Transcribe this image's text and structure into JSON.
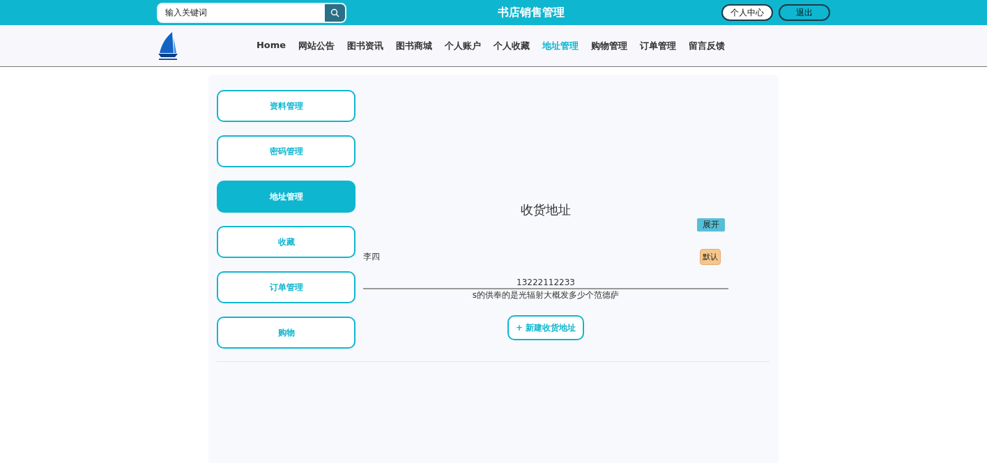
{
  "header": {
    "search": {
      "placeholder": "输入关键词"
    },
    "title": "书店销售管理",
    "buttons": [
      {
        "label": "个人中心",
        "kind": "light"
      },
      {
        "label": "退出",
        "kind": "dark"
      }
    ]
  },
  "nav": {
    "items": [
      {
        "label": "Home",
        "selected": false
      },
      {
        "label": "网站公告",
        "selected": false
      },
      {
        "label": "图书资讯",
        "selected": false
      },
      {
        "label": "图书商城",
        "selected": false
      },
      {
        "label": "个人账户",
        "selected": false
      },
      {
        "label": "个人收藏",
        "selected": false
      },
      {
        "label": "地址管理",
        "selected": true
      },
      {
        "label": "购物管理",
        "selected": false
      },
      {
        "label": "订单管理",
        "selected": false
      },
      {
        "label": "留言反馈",
        "selected": false
      }
    ]
  },
  "sidebar": {
    "items": [
      {
        "label": "资料管理",
        "selected": false
      },
      {
        "label": "密码管理",
        "selected": false
      },
      {
        "label": "地址管理",
        "selected": true
      },
      {
        "label": "收藏",
        "selected": false
      },
      {
        "label": "订单管理",
        "selected": false
      },
      {
        "label": "购物",
        "selected": false
      }
    ]
  },
  "address_panel": {
    "title": "收货地址",
    "expand_button": "展开",
    "addresses": [
      {
        "name": "李四",
        "badge": "默认",
        "phone": "13222112233",
        "address": "s的供奉的是光辐射大概发多少个范德萨"
      }
    ],
    "new_button": "+ 新建收货地址"
  }
}
